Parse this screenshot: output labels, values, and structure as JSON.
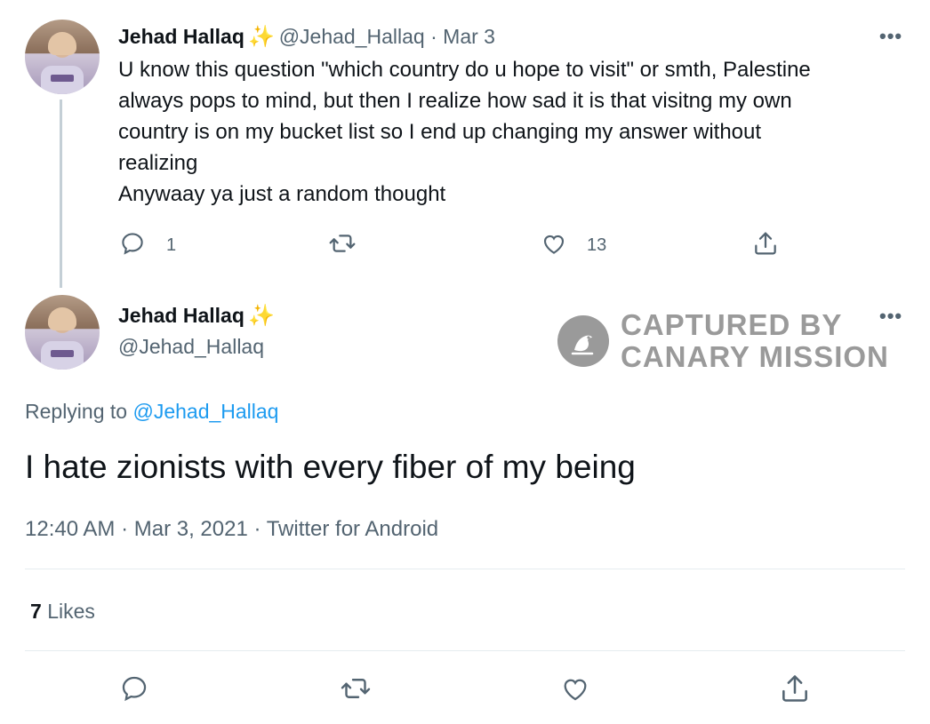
{
  "tweet1": {
    "author_name": "Jehad Hallaq",
    "author_emoji": "✨",
    "handle": "@Jehad_Hallaq",
    "separator": " · ",
    "date": "Mar 3",
    "more_label": "•••",
    "text_lines": [
      "U know this question \"which country do u hope to visit\" or smth, Palestine",
      "always pops to mind, but then I realize how sad it is that visitng my own",
      "country is on my bucket list so I end up changing my answer without",
      "realizing",
      "Anywaay ya just a random thought"
    ],
    "reply_count": "1",
    "like_count": "13"
  },
  "tweet2": {
    "author_name": "Jehad Hallaq",
    "author_emoji": "✨",
    "handle": "@Jehad_Hallaq",
    "more_label": "•••",
    "replying_prefix": "Replying to ",
    "replying_handle": "@Jehad_Hallaq",
    "text": "I hate zionists with every fiber of my being",
    "timestamp": "12:40 AM · Mar 3, 2021 · Twitter for Android",
    "likes_count": "7",
    "likes_label": "Likes"
  },
  "watermark": {
    "line1": "CAPTURED BY",
    "line2": "CANARY MISSION"
  },
  "colors": {
    "link": "#1d9bf0",
    "muted": "#536471",
    "emoji": "#f5c518"
  }
}
